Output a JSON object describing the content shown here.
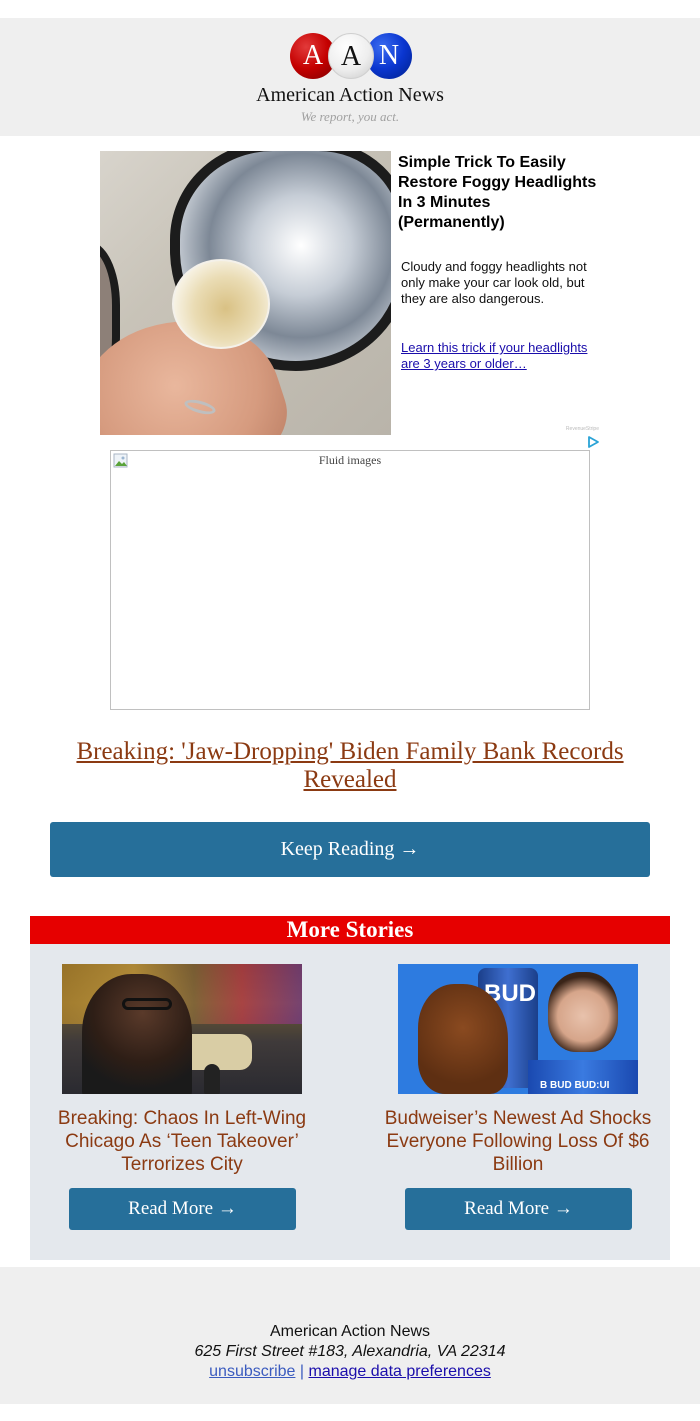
{
  "header": {
    "logo_letters": [
      "A",
      "A",
      "N"
    ],
    "brand_name": "American Action News",
    "tagline": "We report, you act."
  },
  "ad": {
    "image_icon": "headlight-photo",
    "title": "Simple Trick To Easily Restore Foggy Headlights In 3 Minutes (Permanently)",
    "body": "Cloudy and foggy headlights not only make your car look old, but they are also dangerous.",
    "link_text": "Learn this trick if your headlights are 3 years or older…",
    "attribution": "RevenueStripe",
    "adchoices_icon": "adchoices-triangle-icon"
  },
  "fluid_image": {
    "alt_text": "Fluid images",
    "icon": "broken-image-icon"
  },
  "main_story": {
    "headline": "Breaking: 'Jaw-Dropping' Biden Family Bank Records Revealed",
    "button_label": "Keep Reading →"
  },
  "more_stories": {
    "header": "More Stories",
    "items": [
      {
        "title": "Breaking: Chaos In Left-Wing Chicago As ‘Teen Takeover’ Terrorizes City",
        "button_label": "Read More →"
      },
      {
        "title": "Budweiser’s Newest Ad Shocks Everyone Following Loss Of $6 Billion",
        "button_label": "Read More →",
        "image_text": "BUD",
        "pack_text": "B BUD BUD:UI"
      }
    ]
  },
  "footer": {
    "org_name": "American Action News",
    "address": "625 First Street #183, Alexandria, VA 22314",
    "unsubscribe_label": "unsubscribe",
    "separator": "|",
    "manage_label": "manage data preferences"
  },
  "colors": {
    "header_bg": "#efefef",
    "headline": "#8b3a12",
    "button": "#266f9a",
    "more_stories_bar": "#e60000",
    "more_stories_bg": "#e4e8ed",
    "link": "#1a0dab"
  }
}
